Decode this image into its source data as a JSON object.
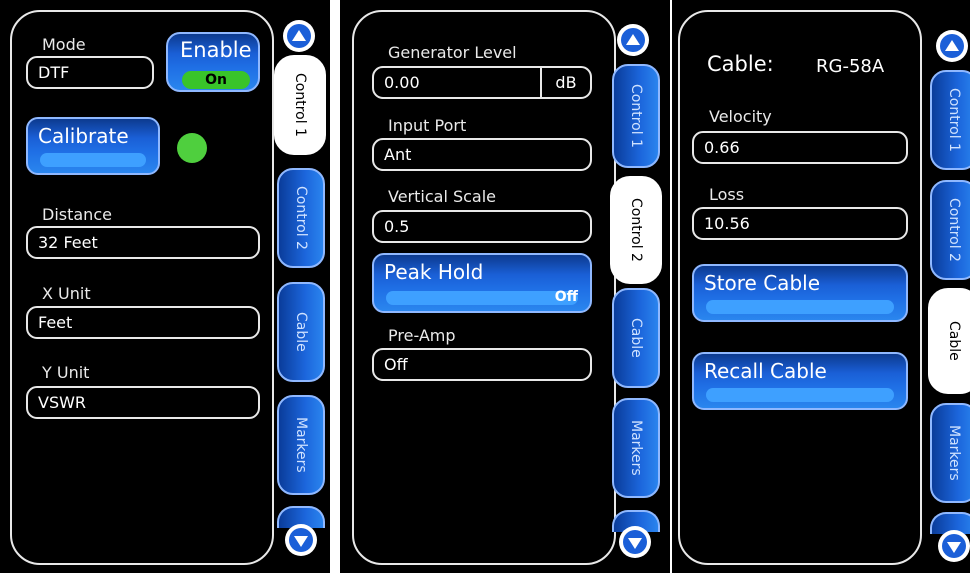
{
  "panel1": {
    "mode_label": "Mode",
    "mode_value": "DTF",
    "enable_label": "Enable",
    "enable_state": "On",
    "calibrate_label": "Calibrate",
    "distance_label": "Distance",
    "distance_value": "32 Feet",
    "xunit_label": "X Unit",
    "xunit_value": "Feet",
    "yunit_label": "Y Unit",
    "yunit_value": "VSWR",
    "tabs": [
      "Control 1",
      "Control 2",
      "Cable",
      "Markers"
    ],
    "active_tab": "Control 1"
  },
  "panel2": {
    "generator_label": "Generator Level",
    "generator_value": "0.00",
    "generator_unit": "dB",
    "input_label": "Input Port",
    "input_value": "Ant",
    "vscale_label": "Vertical Scale",
    "vscale_value": "0.5",
    "peak_label": "Peak Hold",
    "peak_state": "Off",
    "preamp_label": "Pre-Amp",
    "preamp_value": "Off",
    "tabs": [
      "Control 1",
      "Control 2",
      "Cable",
      "Markers"
    ],
    "active_tab": "Control 2"
  },
  "panel3": {
    "cable_label": "Cable:",
    "cable_value": "RG-58A",
    "velocity_label": "Velocity",
    "velocity_value": "0.66",
    "loss_label": "Loss",
    "loss_value": "10.56",
    "store_label": "Store Cable",
    "recall_label": "Recall Cable",
    "tabs": [
      "Control 1",
      "Control 2",
      "Cable",
      "Markers"
    ],
    "active_tab": "Cable"
  },
  "icons": {
    "scroll_up": "arrow-up-icon",
    "scroll_down": "arrow-down-icon",
    "status": "status-led-icon"
  },
  "colors": {
    "accent_blue": "#1c66dc",
    "led_green": "#4fcf3e",
    "background": "#000000"
  }
}
